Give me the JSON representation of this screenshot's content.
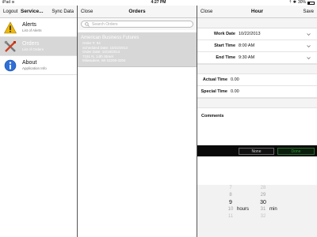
{
  "status_bar": {
    "device": "iPad",
    "wifi_glyph": "≋",
    "time": "4:27 PM",
    "icons": "⇡ ✱",
    "battery": "30%",
    "battery_level": 0.3
  },
  "left_pane": {
    "nav": {
      "left_button": "Logout",
      "title": "Service...",
      "right_button": "Sync Data"
    },
    "items": [
      {
        "title": "Alerts",
        "subtitle": "List of Alerts",
        "icon": "warning-icon",
        "selected": false
      },
      {
        "title": "Orders",
        "subtitle": "List of Orders",
        "icon": "tools-icon",
        "selected": true
      },
      {
        "title": "About",
        "subtitle": "Application Info",
        "icon": "info-icon",
        "selected": false
      }
    ]
  },
  "mid_pane": {
    "nav": {
      "left_button": "Close",
      "title": "Orders"
    },
    "search": {
      "placeholder": "Search Orders"
    },
    "orders": [
      {
        "company": "American Business Futures",
        "lines": [
          "Order #: 94",
          "Scheduled Date: 10/22/2013",
          "Order Date: 10/18/2013",
          "7191 N. 14th Street",
          "Milwaukee, WI 53209-3204"
        ]
      }
    ]
  },
  "right_pane": {
    "nav": {
      "left_button": "Close",
      "title": "Hour",
      "right_button": "Save"
    },
    "fields": [
      {
        "label": "Work Date",
        "value": "10/22/2013"
      },
      {
        "label": "Start Time",
        "value": "8:00 AM"
      },
      {
        "label": "End Time",
        "value": "9:30 AM"
      }
    ],
    "readonly_fields": [
      {
        "label": "Actual Time",
        "value": "0.00"
      },
      {
        "label": "Special Time",
        "value": "0.00"
      }
    ],
    "comments_label": "Comments",
    "picker": {
      "none_label": "None",
      "done_label": "Done",
      "hours": [
        "7",
        "8",
        "9",
        "10",
        "11"
      ],
      "minutes": [
        "28",
        "29",
        "30",
        "31",
        "32"
      ],
      "hours_unit": "hours",
      "minutes_unit": "min"
    }
  }
}
